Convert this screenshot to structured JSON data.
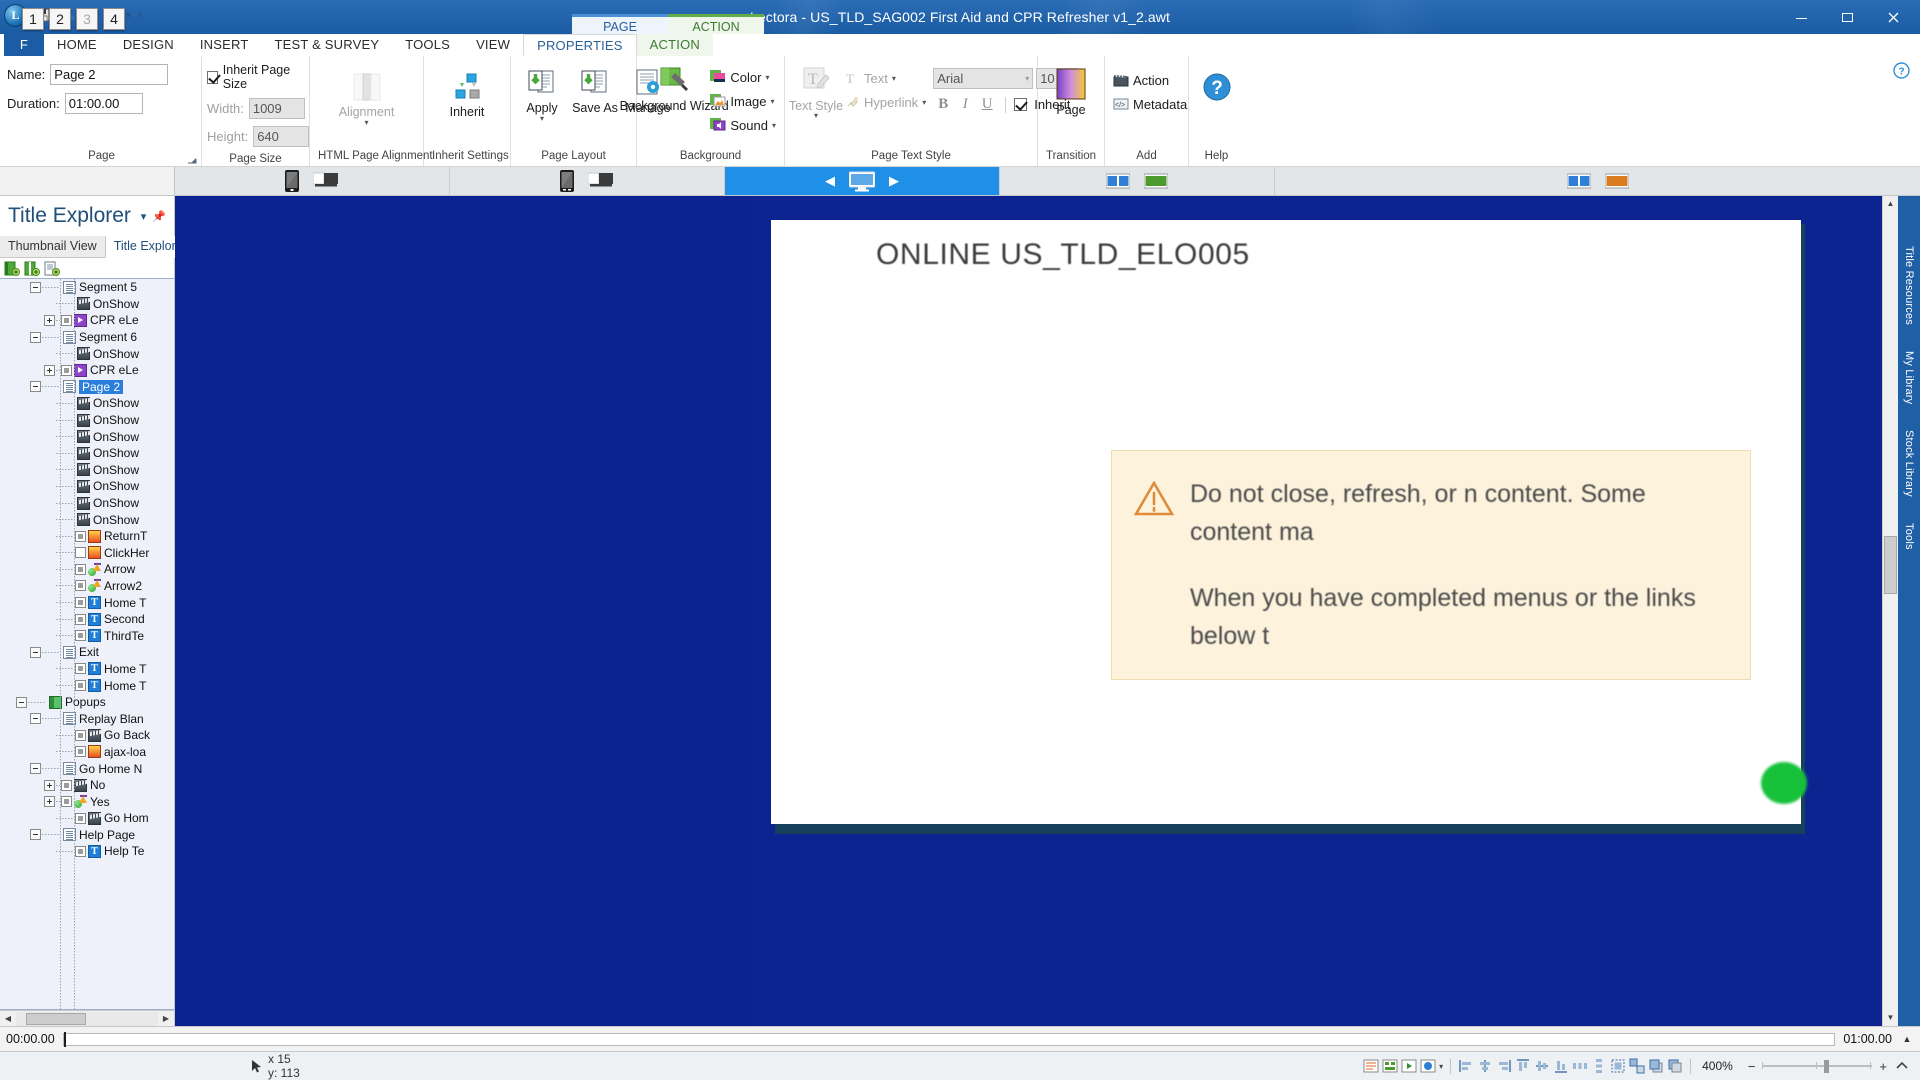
{
  "window": {
    "title": "Lectora - US_TLD_SAG002 First Aid and CPR Refresher v1_2.awt",
    "minimize": "minimize-icon",
    "maximize": "maximize-icon",
    "close": "close-icon",
    "help_icon": "question-circle-icon"
  },
  "quick_access": {
    "app_logo": "L",
    "items": [
      {
        "name": "save-icon",
        "keytip": "1",
        "enabled": true
      },
      {
        "name": "undo-icon",
        "keytip": "2",
        "enabled": true
      },
      {
        "name": "redo-icon",
        "keytip": "3",
        "enabled": false
      },
      {
        "name": "preview-icon",
        "keytip": "4",
        "enabled": true
      }
    ],
    "customize_caret": "▾"
  },
  "contextual_tabs": [
    {
      "label": "PAGE",
      "color": "#4a90d9"
    },
    {
      "label": "ACTION",
      "color": "#63ad49"
    }
  ],
  "ribbon_tabs": [
    {
      "label": "F",
      "type": "file"
    },
    {
      "label": "HOME"
    },
    {
      "label": "DESIGN"
    },
    {
      "label": "INSERT"
    },
    {
      "label": "TEST & SURVEY"
    },
    {
      "label": "TOOLS"
    },
    {
      "label": "VIEW"
    },
    {
      "label": "PROPERTIES",
      "selected": true
    },
    {
      "label": "ACTION",
      "contextual": true
    }
  ],
  "ribbon": {
    "groups": [
      {
        "label": "Page",
        "name": "group-page",
        "fields": [
          {
            "label": "Name:",
            "value": "Page 2",
            "name": "page-name-input"
          },
          {
            "label": "Duration:",
            "value": "01:00.00",
            "name": "page-duration-input"
          }
        ],
        "dialog_launcher": "⌐"
      },
      {
        "label": "Page Size",
        "name": "group-page-size",
        "checkbox": {
          "label": "Inherit Page Size",
          "checked": true
        },
        "fields": [
          {
            "label": "Width:",
            "value": "1009",
            "readonly": true
          },
          {
            "label": "Height:",
            "value": "640",
            "readonly": true
          }
        ]
      },
      {
        "label": "HTML Page Alignment",
        "name": "group-html-page-alignment",
        "buttons": [
          {
            "label": "Alignment",
            "icon": "alignment-icon",
            "disabled": true,
            "dropdown": true
          }
        ]
      },
      {
        "label": "Inherit Settings",
        "name": "group-inherit-settings",
        "buttons": [
          {
            "label": "Inherit",
            "icon": "inherit-icon"
          }
        ]
      },
      {
        "label": "Page Layout",
        "name": "group-page-layout",
        "buttons": [
          {
            "label": "Apply",
            "icon": "apply-layout-icon",
            "dropdown": true
          },
          {
            "label": "Save As",
            "icon": "save-as-layout-icon"
          },
          {
            "label": "Manage",
            "icon": "manage-layout-icon"
          }
        ]
      },
      {
        "label": "Background",
        "name": "group-background",
        "buttons": [
          {
            "label": "Background Wizard",
            "icon": "background-wizard-icon"
          }
        ],
        "small_buttons": [
          {
            "label": "Color",
            "icon": "color-icon",
            "dropdown": true
          },
          {
            "label": "Image",
            "icon": "image-icon",
            "dropdown": true
          },
          {
            "label": "Sound",
            "icon": "sound-icon",
            "dropdown": true
          }
        ]
      },
      {
        "label": "Page Text Style",
        "name": "group-page-text-style",
        "buttons": [
          {
            "label": "Text Style",
            "icon": "text-style-icon",
            "dropdown": true
          }
        ],
        "small_buttons": [
          {
            "label": "Text",
            "icon": "text-icon",
            "dropdown": true,
            "disabled": true
          },
          {
            "label": "Hyperlink",
            "icon": "hyperlink-icon",
            "dropdown": true,
            "disabled": true
          }
        ],
        "font_name": "Arial",
        "font_size": "10",
        "bold": "B",
        "italic": "I",
        "underline": "U",
        "inherit_checkbox": {
          "label": "Inherit",
          "checked": true
        }
      },
      {
        "label": "Transition",
        "name": "group-transition",
        "buttons": [
          {
            "label": "Page",
            "icon": "page-transition-icon"
          }
        ]
      },
      {
        "label": "Add",
        "name": "group-add",
        "small_buttons": [
          {
            "label": "Action",
            "icon": "action-icon"
          },
          {
            "label": "Metadata",
            "icon": "metadata-icon"
          }
        ]
      },
      {
        "label": "Help",
        "name": "group-help",
        "buttons": [
          {
            "label": "Help",
            "icon": "help-icon",
            "hide_caption": true
          }
        ]
      }
    ]
  },
  "device_bar": {
    "segments": [
      {
        "name": "desktop-group-1",
        "icons": [
          "phone-icon",
          "desktop-icon"
        ],
        "active": false
      },
      {
        "name": "desktop-group-2",
        "icons": [
          "phone-icon",
          "desktop-icon"
        ],
        "active": false
      },
      {
        "name": "responsive-current",
        "icons": [
          "monitor-icon"
        ],
        "active": true,
        "left_arrow": "◀",
        "right_arrow": "▶"
      },
      {
        "name": "view-group-3",
        "icons": [
          "book-blue-icon",
          "book-green-icon"
        ],
        "active": false
      },
      {
        "name": "view-group-4",
        "icons": [
          "book-blue-icon",
          "book-orange-icon"
        ],
        "active": false
      }
    ]
  },
  "title_explorer": {
    "panel_title": "Title Explorer",
    "collapse_caret": "▾",
    "pin_icon": "pin-icon",
    "tabs": [
      {
        "label": "Thumbnail View",
        "selected": false
      },
      {
        "label": "Title Explorer",
        "selected": true
      }
    ],
    "toolbar_icons": [
      "add-chapter-icon",
      "add-section-icon",
      "add-page-icon"
    ],
    "tree": [
      {
        "indent": 3,
        "toggle": "minus",
        "icon": "page-icon",
        "label": "Segment 5"
      },
      {
        "indent": 4,
        "toggle": "none",
        "icon": "action-icon",
        "label": "OnShow"
      },
      {
        "indent": 4,
        "toggle": "plus",
        "check": "filled",
        "icon": "media-icon",
        "label": "CPR eLe"
      },
      {
        "indent": 3,
        "toggle": "minus",
        "icon": "page-icon",
        "label": "Segment 6"
      },
      {
        "indent": 4,
        "toggle": "none",
        "icon": "action-icon",
        "label": "OnShow"
      },
      {
        "indent": 4,
        "toggle": "plus",
        "check": "filled",
        "icon": "media-icon",
        "label": "CPR eLe"
      },
      {
        "indent": 3,
        "toggle": "minus",
        "icon": "page-icon",
        "label": "Page 2",
        "selected": true
      },
      {
        "indent": 4,
        "toggle": "none",
        "icon": "action-icon",
        "label": "OnShow"
      },
      {
        "indent": 4,
        "toggle": "none",
        "icon": "action-icon",
        "label": "OnShow"
      },
      {
        "indent": 4,
        "toggle": "none",
        "icon": "action-icon",
        "label": "OnShow"
      },
      {
        "indent": 4,
        "toggle": "none",
        "icon": "action-icon",
        "label": "OnShow"
      },
      {
        "indent": 4,
        "toggle": "none",
        "icon": "action-icon",
        "label": "OnShow"
      },
      {
        "indent": 4,
        "toggle": "none",
        "icon": "action-icon",
        "label": "OnShow"
      },
      {
        "indent": 4,
        "toggle": "none",
        "icon": "action-icon",
        "label": "OnShow"
      },
      {
        "indent": 4,
        "toggle": "none",
        "icon": "action-icon",
        "label": "OnShow"
      },
      {
        "indent": 4,
        "toggle": "none",
        "check": "filled",
        "icon": "image-icon",
        "label": "ReturnT"
      },
      {
        "indent": 4,
        "toggle": "none",
        "check": "empty",
        "icon": "image-icon",
        "label": "ClickHer"
      },
      {
        "indent": 4,
        "toggle": "none",
        "check": "filled",
        "icon": "arrow-icon",
        "label": "Arrow"
      },
      {
        "indent": 4,
        "toggle": "none",
        "check": "filled",
        "icon": "arrow-icon",
        "label": "Arrow2"
      },
      {
        "indent": 4,
        "toggle": "none",
        "check": "filled",
        "icon": "text-icon",
        "label": "Home T"
      },
      {
        "indent": 4,
        "toggle": "none",
        "check": "filled",
        "icon": "text-icon",
        "label": "Second"
      },
      {
        "indent": 4,
        "toggle": "none",
        "check": "filled",
        "icon": "text-icon",
        "label": "ThirdTe"
      },
      {
        "indent": 3,
        "toggle": "minus",
        "icon": "page-icon",
        "label": "Exit"
      },
      {
        "indent": 4,
        "toggle": "none",
        "check": "filled",
        "icon": "text-icon",
        "label": "Home T"
      },
      {
        "indent": 4,
        "toggle": "none",
        "check": "filled",
        "icon": "text-icon",
        "label": "Home T"
      },
      {
        "indent": 2,
        "toggle": "minus",
        "icon": "book-icon",
        "label": "Popups"
      },
      {
        "indent": 3,
        "toggle": "minus",
        "icon": "page-icon",
        "label": "Replay Blan"
      },
      {
        "indent": 4,
        "toggle": "none",
        "check": "filled",
        "icon": "action-icon",
        "label": "Go Back"
      },
      {
        "indent": 4,
        "toggle": "none",
        "check": "filled",
        "icon": "image-icon",
        "label": "ajax-loa"
      },
      {
        "indent": 3,
        "toggle": "minus",
        "icon": "page-icon",
        "label": "Go Home N"
      },
      {
        "indent": 4,
        "toggle": "plus",
        "check": "filled",
        "icon": "action-icon",
        "label": "No"
      },
      {
        "indent": 4,
        "toggle": "plus",
        "check": "filled",
        "icon": "arrow-icon",
        "label": "Yes"
      },
      {
        "indent": 4,
        "toggle": "none",
        "check": "filled",
        "icon": "action-icon",
        "label": "Go Hom"
      },
      {
        "indent": 3,
        "toggle": "minus",
        "icon": "page-icon",
        "label": "Help Page"
      },
      {
        "indent": 4,
        "toggle": "none",
        "check": "filled",
        "icon": "text-icon",
        "label": "Help Te"
      }
    ],
    "hscroll": {
      "left_arrow": "◀",
      "right_arrow": "▶",
      "grip": "⁞⁞"
    }
  },
  "canvas": {
    "page_heading": "ONLINE US_TLD_ELO005",
    "notice": {
      "icon": "warning-triangle-icon",
      "paragraphs": [
        "Do not close, refresh, or n content. Some content ma",
        "When you have completed menus or the links below t"
      ]
    },
    "scroll": {
      "up_arrow": "▲",
      "down_arrow": "▼"
    }
  },
  "right_dock": {
    "tabs": [
      "Title Resources",
      "My Library",
      "Stock Library",
      "Tools"
    ]
  },
  "timeline": {
    "start": "00:00.00",
    "end": "01:00.00",
    "expand_icon": "▲"
  },
  "status_bar": {
    "cursor_icon": "cursor-icon",
    "coordinates": "x 15  y: 113",
    "left_icons": [
      "mode-text-icon",
      "mode-grid-icon",
      "mode-play-icon",
      "mode-publish-icon"
    ],
    "align_icons": [
      "align-left-icon",
      "align-center-icon",
      "align-right-icon",
      "align-top-icon",
      "align-middle-icon",
      "align-bottom-icon",
      "distribute-h-icon",
      "distribute-v-icon",
      "group-icon",
      "ungroup-icon",
      "bring-front-icon",
      "send-back-icon"
    ],
    "zoom_level": "400%",
    "zoom_out": "−",
    "zoom_in": "+",
    "fit_icon": "fit-page-icon"
  },
  "colors": {
    "titlebar": "#1b5ca4",
    "accent_blue": "#1e90e8",
    "canvas_blue": "#0c2490",
    "selection": "#2a7fdc",
    "notice_bg": "#fdf3dd",
    "green": "#63ad49"
  }
}
